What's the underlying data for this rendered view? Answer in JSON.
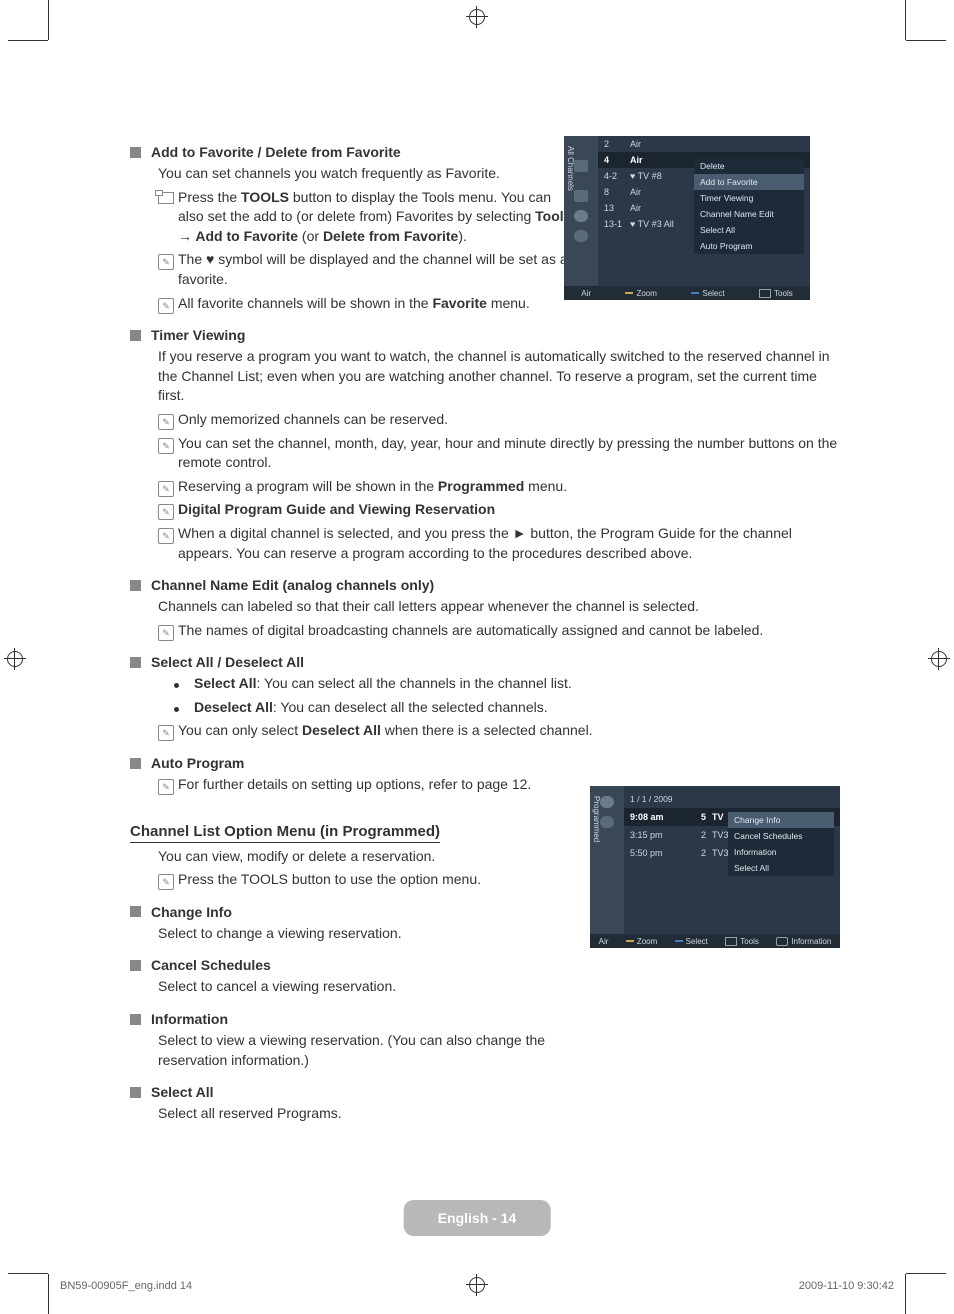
{
  "sections": {
    "add_favorite": {
      "title": "Add to Favorite / Delete from Favorite",
      "intro": "You can set channels you watch frequently as Favorite.",
      "tool_note_pre": "Press the ",
      "tool_note_bold": "TOOLS",
      "tool_note_mid": " button to display the Tools menu. You can also set the add to (or delete from) Favorites by selecting ",
      "tool_note_b2": "Tools → Add to Favorite",
      "tool_note_mid2": " (or ",
      "tool_note_b3": "Delete from Favorite",
      "tool_note_end": ").",
      "heart_note": "The ♥ symbol will be displayed and the channel will be set as a favorite.",
      "fav_menu_pre": "All favorite channels will be shown in the ",
      "fav_menu_bold": "Favorite",
      "fav_menu_end": " menu."
    },
    "timer": {
      "title": "Timer Viewing",
      "intro": "If you reserve a program you want to watch, the channel is automatically switched to the reserved channel in the Channel List; even when you are watching another channel. To reserve a program, set the current time first.",
      "n1": "Only memorized channels can be reserved.",
      "n2": "You can set the channel, month, day, year, hour and minute directly by pressing the number buttons on the remote control.",
      "n3_pre": "Reserving a program will be shown in the ",
      "n3_bold": "Programmed",
      "n3_end": " menu.",
      "n4": "Digital Program Guide and Viewing Reservation",
      "n5": "When a digital channel is selected, and you press the ► button, the Program Guide for the channel appears. You can reserve a program according to the procedures described above."
    },
    "cne": {
      "title": "Channel Name Edit (analog channels only)",
      "intro": "Channels can labeled so that their call letters appear whenever the channel is selected.",
      "n1": "The names of digital broadcasting channels are automatically assigned and cannot be labeled."
    },
    "selall": {
      "title": "Select All / Deselect All",
      "b1_bold": "Select All",
      "b1_rest": ": You can select all the channels in the channel list.",
      "b2_bold": "Deselect All",
      "b2_rest": ": You can deselect all the selected channels.",
      "n1_pre": "You can only select ",
      "n1_bold": "Deselect All",
      "n1_end": " when there is a selected channel."
    },
    "auto": {
      "title": "Auto Program",
      "n1": "For further details on setting up options, refer to page 12."
    },
    "prog_menu": {
      "heading": "Channel List Option Menu (in Programmed)",
      "intro": "You can view, modify or delete a reservation.",
      "n1": "Press the TOOLS button to use the option menu.",
      "ci_title": "Change Info",
      "ci_body": "Select to change a viewing reservation.",
      "cs_title": "Cancel Schedules",
      "cs_body": "Select to cancel a viewing reservation.",
      "info_title": "Information",
      "info_body": "Select to view a viewing reservation. (You can also change the reservation information.)",
      "sa_title": "Select All",
      "sa_body": "Select all reserved Programs."
    }
  },
  "osd1": {
    "side_label": "All Channels",
    "rows": [
      {
        "num": "2",
        "name": "Air"
      },
      {
        "num": "4",
        "name": "Air",
        "sel": true
      },
      {
        "num": "4-2",
        "name": "♥ TV #8"
      },
      {
        "num": "8",
        "name": "Air"
      },
      {
        "num": "13",
        "name": "Air"
      },
      {
        "num": "13-1",
        "name": "♥ TV #3   All"
      }
    ],
    "menu": [
      "Delete",
      "Add to Favorite",
      "Timer Viewing",
      "Channel Name Edit",
      "Select All",
      "Auto Program"
    ],
    "menu_hl_index": 1,
    "bar": {
      "left": "Air",
      "zoom": "Zoom",
      "select": "Select",
      "tools": "Tools"
    }
  },
  "osd2": {
    "side_label": "Programmed",
    "date": "1 / 1 / 2009",
    "rows": [
      {
        "time": "9:08 am",
        "num": "5",
        "ch": "TV",
        "sel": true
      },
      {
        "time": "3:15 pm",
        "num": "2",
        "ch": "TV3"
      },
      {
        "time": "5:50 pm",
        "num": "2",
        "ch": "TV3"
      }
    ],
    "menu": [
      "Change Info",
      "Cancel Schedules",
      "Information",
      "Select All"
    ],
    "menu_hl_index": 0,
    "bar": {
      "left": "Air",
      "zoom": "Zoom",
      "select": "Select",
      "tools": "Tools",
      "info": "Information"
    }
  },
  "footer": {
    "pill": "English - 14",
    "left": "BN59-00905F_eng.indd   14",
    "right": "2009-11-10   9:30:42"
  }
}
